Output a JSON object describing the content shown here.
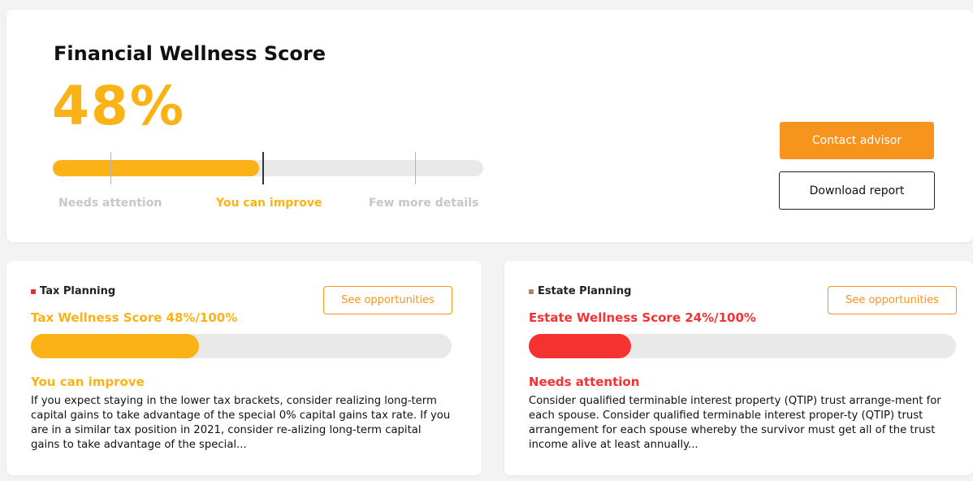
{
  "colors": {
    "accent": "#fbb217",
    "orange_button": "#f7941d",
    "danger": "#f53232",
    "tax_dot": "#e0303e",
    "estate_dot": "#a68870",
    "muted": "#c7c7c7"
  },
  "summary": {
    "title": "Financial Wellness Score",
    "score_text": "48%",
    "score_value": 48,
    "segments": [
      {
        "label": "Needs attention",
        "active": false
      },
      {
        "label": "You can improve",
        "active": true
      },
      {
        "label": "Few more details",
        "active": false
      }
    ],
    "actions": {
      "contact_label": "Contact advisor",
      "download_label": "Download report"
    }
  },
  "tax": {
    "category": "Tax Planning",
    "opportunities_label": "See opportunities",
    "score_text": "Tax Wellness Score 48%/100%",
    "score_value": 48,
    "status": "You can improve",
    "description": "If you expect staying in the lower tax brackets, consider realizing long-term capital gains to take advantage of the special 0% capital gains tax rate. If you are in a similar tax position in 2021, consider re-alizing long-term capital gains to take advantage of the special..."
  },
  "estate": {
    "category": "Estate Planning",
    "opportunities_label": "See opportunities",
    "score_text": "Estate Wellness Score 24%/100%",
    "score_value": 24,
    "status": "Needs attention",
    "description": "Consider qualified terminable interest property (QTIP) trust arrange-ment for each spouse. Consider qualified terminable interest proper-ty (QTIP) trust arrangement for each spouse whereby the survivor must get all of the trust income alive at least annually..."
  }
}
